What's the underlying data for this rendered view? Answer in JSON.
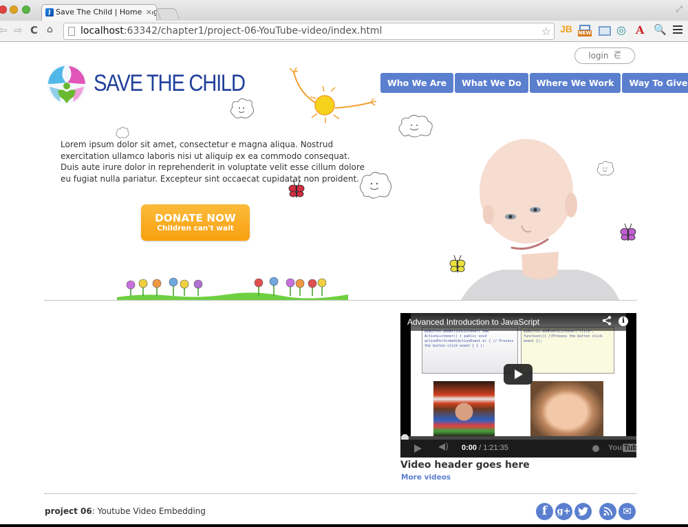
{
  "browser": {
    "tab_title": "Save The Child | Home Pag",
    "tab_close": "×",
    "url_host": "localhost",
    "url_rest": ":63342/chapter1/project-06-YouTube-video/index.html",
    "icons": {
      "back": "⇦",
      "forward": "⇨",
      "reload": "C",
      "home": "⌂",
      "star": "☆",
      "ext_jb": "JB",
      "ext_new": "NEW",
      "ext_wave": "◎",
      "ext_acrobat": "A",
      "ext_search": "🔍",
      "fullscreen": "⤢",
      "favicon": "J"
    }
  },
  "header": {
    "logo_text": "SAVE THE CHILD",
    "login_label": "login",
    "login_icon": "⋶",
    "nav": [
      {
        "label": "Who We Are"
      },
      {
        "label": "What We Do"
      },
      {
        "label": "Where We Work"
      },
      {
        "label": "Way To Give"
      }
    ]
  },
  "main": {
    "intro": "Lorem ipsum dolor sit amet, consectetur e magna aliqua. Nostrud exercitation ullamco laboris nisi ut aliquip ex ea commodo consequat. Duis aute irure dolor in reprehenderit in voluptate velit esse cillum dolore eu fugiat nulla pariatur. Excepteur sint occaecat cupidatat non proident.",
    "donate": {
      "main": "DONATE NOW",
      "sub": "Children can't wait"
    }
  },
  "video": {
    "title": "Advanced Introduction to JavaScript",
    "slide_left_code": "myButton.addActionListener( new ActionListener() { public void actionPerformed(ActionEvent e) { // Process the button click event } } );",
    "slide_right_code": "myButton.addEventListener(\"click\", function(){ //Process the button click event });",
    "current_time": "0:00",
    "duration": "/ 1:21:35",
    "progress_fraction": 0,
    "youtube_you": "You",
    "youtube_tube": "Tube",
    "share_icon": "<",
    "info_icon": "i",
    "volume_icon": "◀)",
    "header": "Video header goes here",
    "more_link": "More videos"
  },
  "footer": {
    "project_label": "project 06",
    "project_desc": ": Youtube Video Embedding",
    "social": [
      {
        "name": "facebook",
        "glyph": "f"
      },
      {
        "name": "google-plus",
        "glyph": "g+"
      },
      {
        "name": "twitter",
        "glyph": "🐦"
      },
      {
        "name": "rss",
        "glyph": "◣"
      },
      {
        "name": "email",
        "glyph": "✉"
      }
    ]
  }
}
